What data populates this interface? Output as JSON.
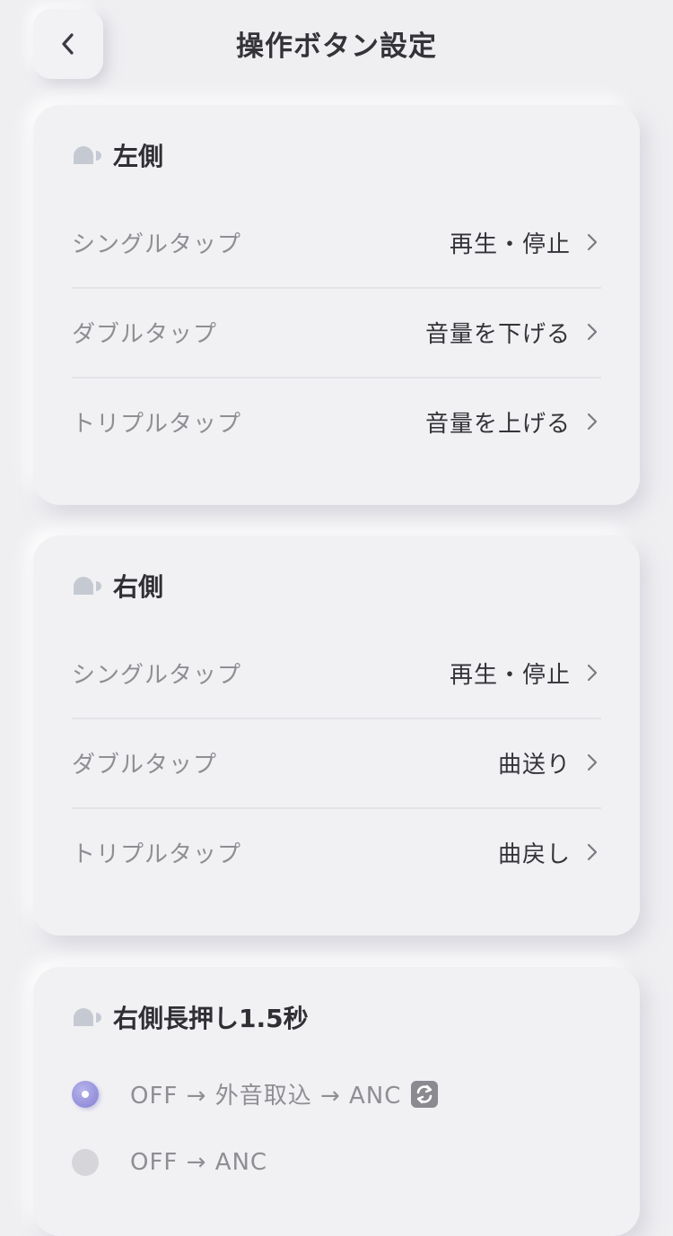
{
  "header": {
    "title": "操作ボタン設定",
    "back_icon": "chevron-left-icon"
  },
  "colors": {
    "background": "#efeff2",
    "accent": "#8480d2",
    "text_primary": "#333338",
    "text_secondary": "#8e8e93"
  },
  "left": {
    "title": "左側",
    "rows": [
      {
        "label": "シングルタップ",
        "value": "再生・停止"
      },
      {
        "label": "ダブルタップ",
        "value": "音量を下げる"
      },
      {
        "label": "トリプルタップ",
        "value": "音量を上げる"
      }
    ]
  },
  "right": {
    "title": "右側",
    "rows": [
      {
        "label": "シングルタップ",
        "value": "再生・停止"
      },
      {
        "label": "ダブルタップ",
        "value": "曲送り"
      },
      {
        "label": "トリプルタップ",
        "value": "曲戻し"
      }
    ]
  },
  "long_press": {
    "title": "右側長押し1.5秒",
    "options": [
      {
        "label": "OFF → 外音取込 → ANC",
        "selected": true,
        "icon": "cycle-icon"
      },
      {
        "label": "OFF → ANC",
        "selected": false
      }
    ]
  }
}
